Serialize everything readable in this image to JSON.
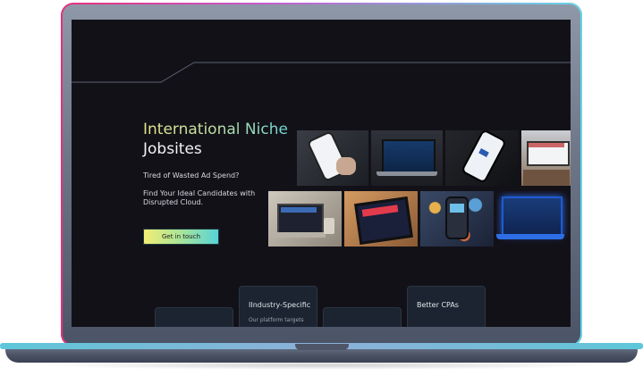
{
  "hero": {
    "title_line1": "International Niche",
    "title_line2": "Jobsites",
    "subtitle_1": "Tired of Wasted Ad Spend?",
    "subtitle_2": "Find Your Ideal Candidates with Disrupted Cloud.",
    "cta_label": "Get in touch"
  },
  "features": [
    {
      "title": "",
      "text": ""
    },
    {
      "title": "IIndustry-Specific",
      "text": "Our platform targets"
    },
    {
      "title": "",
      "text": ""
    },
    {
      "title": "Better CPAs",
      "text": ""
    }
  ],
  "colors": {
    "screen_bg": "#131118",
    "accent_gradient_start": "#f4ee72",
    "accent_gradient_end": "#55d3d9",
    "bezel_pink": "#e82f7a",
    "bezel_cyan": "#66d6e6"
  }
}
